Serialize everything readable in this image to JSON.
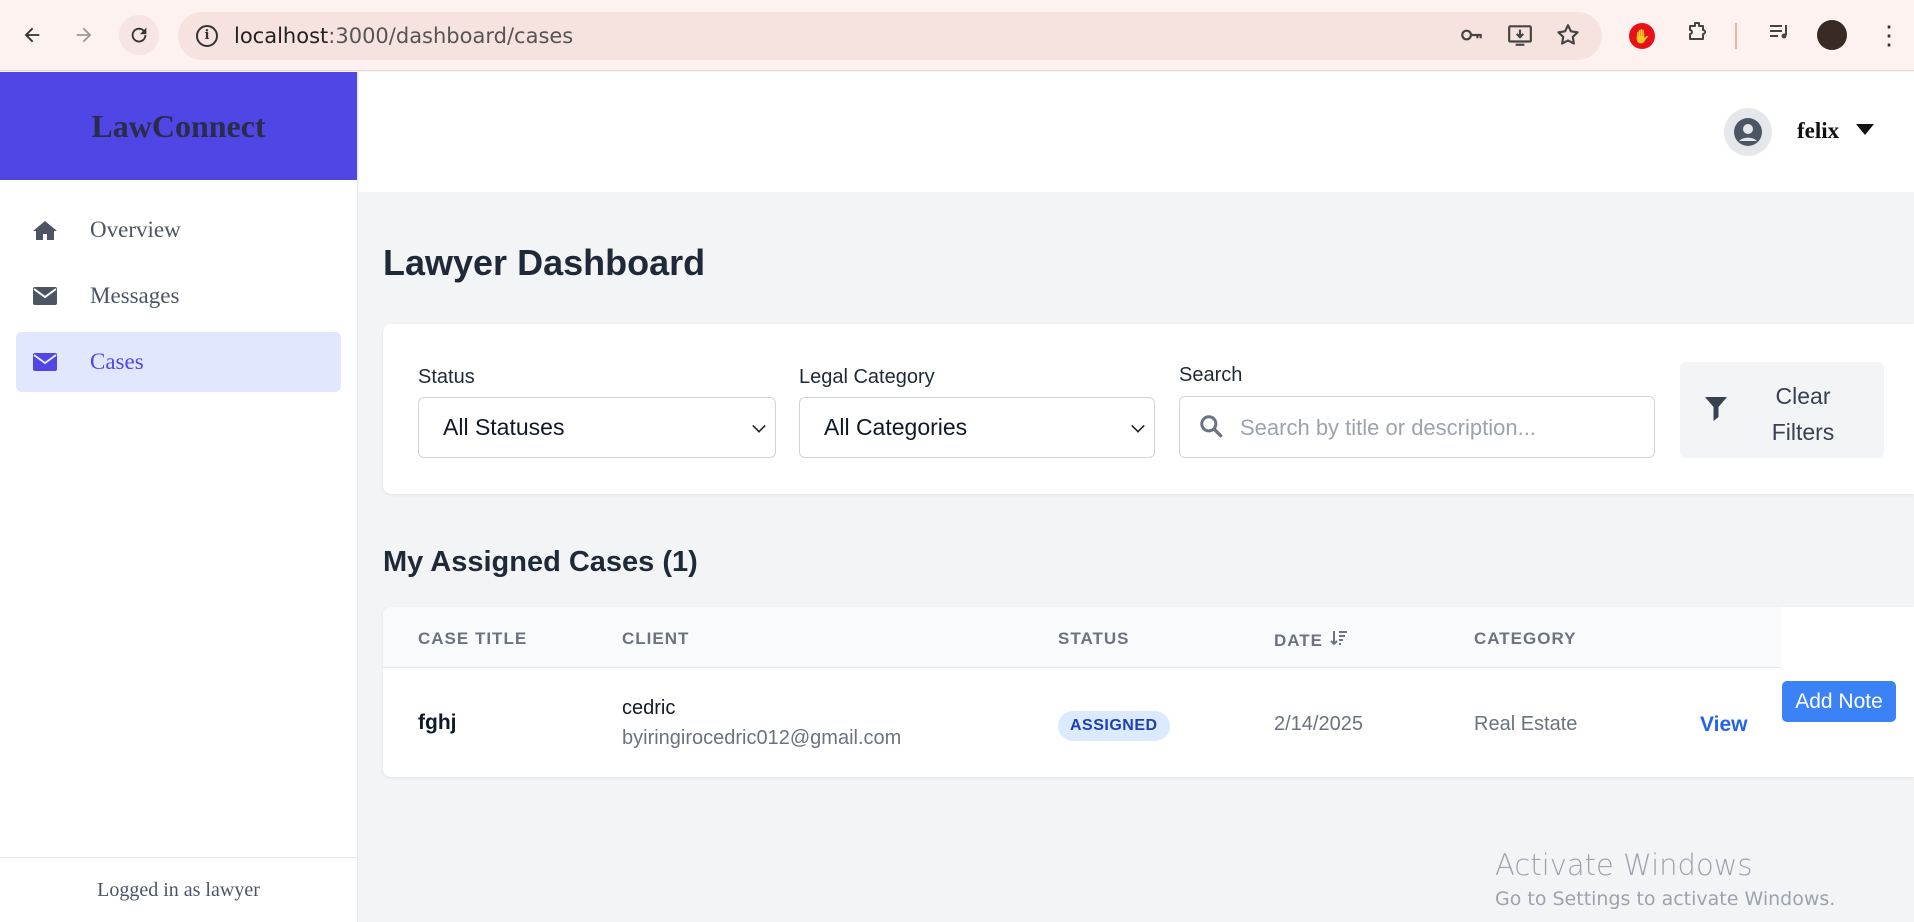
{
  "browser": {
    "url_host": "localhost",
    "url_path": ":3000/dashboard/cases"
  },
  "sidebar": {
    "brand": "LawConnect",
    "items": [
      {
        "label": "Overview",
        "icon": "home-icon"
      },
      {
        "label": "Messages",
        "icon": "envelope-icon"
      },
      {
        "label": "Cases",
        "icon": "envelope-icon",
        "active": true
      }
    ],
    "footer": "Logged in as lawyer"
  },
  "header": {
    "user_name": "felix"
  },
  "main": {
    "title": "Lawyer Dashboard",
    "filters": {
      "status_label": "Status",
      "status_value": "All Statuses",
      "category_label": "Legal Category",
      "category_value": "All Categories",
      "search_label": "Search",
      "search_placeholder": "Search by title or description...",
      "clear_label_line1": "Clear",
      "clear_label_line2": "Filters"
    },
    "section_title": "My Assigned Cases (1)",
    "table": {
      "headers": [
        "CASE TITLE",
        "CLIENT",
        "STATUS",
        "DATE",
        "CATEGORY"
      ],
      "rows": [
        {
          "title": "fghj",
          "client_name": "cedric",
          "client_email": "byiringirocedric012@gmail.com",
          "status": "ASSIGNED",
          "date": "2/14/2025",
          "category": "Real Estate",
          "view_label": "View",
          "note_label": "Add Note"
        }
      ]
    }
  },
  "watermark": {
    "line1": "Activate Windows",
    "line2": "Go to Settings to activate Windows."
  },
  "colors": {
    "brand": "#4f46e5",
    "active_bg": "#e0e7ff",
    "badge_bg": "#dbeafe",
    "button": "#3b82f6",
    "link": "#2563eb"
  }
}
